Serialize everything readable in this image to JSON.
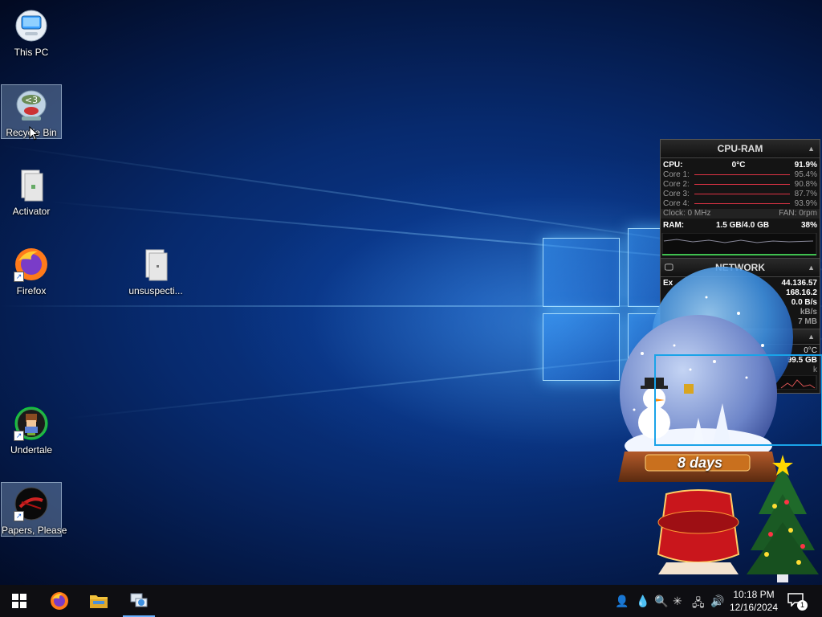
{
  "desktop": {
    "icons": [
      {
        "label": "This PC"
      },
      {
        "label": "Recycle Bin"
      },
      {
        "label": "Activator"
      },
      {
        "label": "Firefox"
      },
      {
        "label": "unsuspecti..."
      },
      {
        "label": "Undertale"
      },
      {
        "label": "Papers, Please"
      }
    ]
  },
  "gadget": {
    "cpu_ram": {
      "title": "CPU-RAM",
      "cpu_label": "CPU:",
      "cpu_temp": "0°C",
      "cpu_percent": "91.9%",
      "cores": [
        {
          "label": "Core 1:",
          "value": "95.4%"
        },
        {
          "label": "Core 2:",
          "value": "90.8%"
        },
        {
          "label": "Core 3:",
          "value": "87.7%"
        },
        {
          "label": "Core 4:",
          "value": "93.9%"
        }
      ],
      "clock": "Clock: 0 MHz",
      "fan": "FAN: 0rpm",
      "ram_label": "RAM:",
      "ram_value": "1.5 GB/4.0 GB",
      "ram_percent": "38%"
    },
    "network": {
      "title": "NETWORK",
      "ext_ip": "44.136.57",
      "int_ip": "168.16.2",
      "rate": "0.0 B/s",
      "rate2": "kB/s",
      "total": "7 MB",
      "row_prefix": "Ex"
    },
    "drive": {
      "temp": "0°C",
      "size": "99.5 GB",
      "tail": "k"
    }
  },
  "snowglobe": {
    "countdown": "8 days"
  },
  "taskbar": {
    "time": "10:18 PM",
    "date": "12/16/2024",
    "notification_count": "1"
  },
  "colors": {
    "accent": "#6ab0ff",
    "cpu_bar": "#dd3344",
    "ram_bar": "#3fbf4f"
  }
}
